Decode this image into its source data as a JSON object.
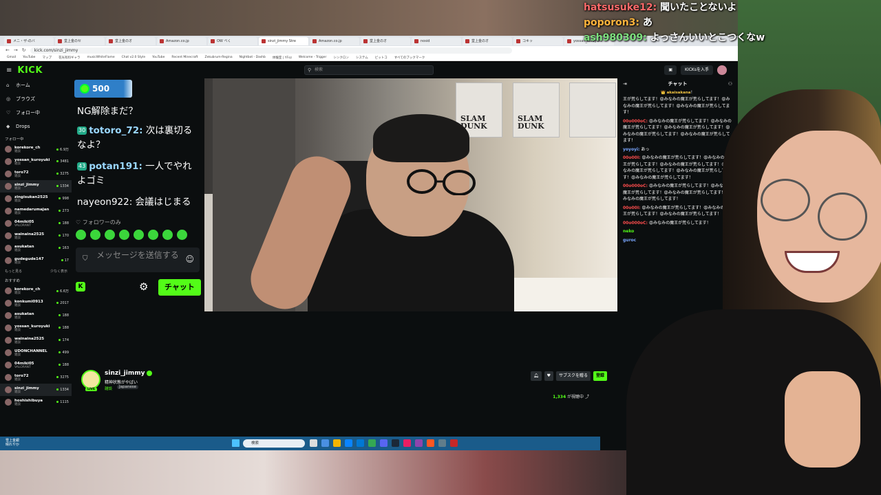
{
  "overlay_chat": [
    {
      "user": "hatsusuke12:",
      "text": "聞いたことないよ",
      "cls": ""
    },
    {
      "user": "poporon3:",
      "text": "あ",
      "cls": "y"
    },
    {
      "user": "ash980309:",
      "text": "よっさんいいとこつくなw",
      "cls": "g"
    }
  ],
  "browser": {
    "tabs": [
      "メニ・ザ-のバ",
      "堂上金のセ",
      "堂上金のオ",
      "Amazon.co.jp",
      "OW べく",
      "sinzi_jimmy Stre",
      "Amazon.co.jp",
      "堂上金のオ",
      "nosid",
      "堂上金のオ",
      "コキッ",
      "yossan_kuroyuki"
    ],
    "url": "kick.com/sinzi_jimmy",
    "bookmarks": [
      "Gmail",
      "YouTube",
      "マップ",
      "花光有料ギャラ",
      "musicWhiteFlame",
      "Chat v2.0 Style",
      "YouTube",
      "Recent Minecraft",
      "Zekubrum-Regina",
      "Nightbot - Dashb",
      "体験室 | YFsz",
      "Welcome - Trigger",
      "シンクロン",
      "システム",
      "ビットコ",
      "すべてのブックマーク"
    ]
  },
  "kick": {
    "logo": "KICK",
    "search_placeholder": "検索",
    "get_kicks": "KICKsを入手",
    "nav": [
      {
        "label": "ホーム",
        "icon": "home-icon",
        "glyph": "⌂"
      },
      {
        "label": "ブラウズ",
        "icon": "browse-icon",
        "glyph": "◎"
      },
      {
        "label": "フォロー中",
        "icon": "heart-icon",
        "glyph": "♡"
      },
      {
        "label": "Drops",
        "icon": "drops-icon",
        "glyph": "◆"
      }
    ],
    "following_title": "フォロー中",
    "following": [
      {
        "name": "korekore_ch",
        "cat": "雑談",
        "viewers": "6.9万"
      },
      {
        "name": "yossan_kuroyuki",
        "cat": "雑談",
        "viewers": "3481"
      },
      {
        "name": "toro72",
        "cat": "雑談",
        "viewers": "3275"
      },
      {
        "name": "sinzi_jimmy",
        "cat": "雑談",
        "viewers": "1334"
      },
      {
        "name": "zingisukan2525",
        "cat": "雑談",
        "viewers": "998"
      },
      {
        "name": "namedarumajan",
        "cat": "雑談",
        "viewers": "273"
      },
      {
        "name": "04miki05",
        "cat": "VALORANT",
        "viewers": "188"
      },
      {
        "name": "wainaina2525",
        "cat": "雑談",
        "viewers": "170"
      },
      {
        "name": "asukatan",
        "cat": "雑談",
        "viewers": "163"
      },
      {
        "name": "gudegude147",
        "cat": "雑談",
        "viewers": "17"
      }
    ],
    "show_more": "もっと見る",
    "show_less": "少なく表示",
    "recommended_title": "おすすめ",
    "recommended": [
      {
        "name": "korekore_ch",
        "cat": "雑談",
        "viewers": "6.6万"
      },
      {
        "name": "konkumi0913",
        "cat": "雑談",
        "viewers": "2017"
      },
      {
        "name": "asukatan",
        "cat": "雑談",
        "viewers": "188"
      },
      {
        "name": "yossan_kuroyuki",
        "cat": "雑談",
        "viewers": "188"
      },
      {
        "name": "wainaina2525",
        "cat": "雑談",
        "viewers": "174"
      },
      {
        "name": "UDONCHANNEL",
        "cat": "雑談",
        "viewers": "499"
      },
      {
        "name": "04miki05",
        "cat": "VALORANT",
        "viewers": "188"
      },
      {
        "name": "toro72",
        "cat": "雑談",
        "viewers": "3275"
      },
      {
        "name": "sinzi_jimmy",
        "cat": "雑談",
        "viewers": "1334"
      },
      {
        "name": "hoshishibuya",
        "cat": "雑談",
        "viewers": "1115"
      }
    ],
    "points": "500",
    "overlay_msgs": [
      {
        "badge": "",
        "user": "",
        "text": "NG解除まだ？"
      },
      {
        "badge": "30",
        "user": "totoro_72:",
        "text": " 次は裏切るなよ？"
      },
      {
        "badge": "43",
        "user": "potan191:",
        "text": " 一人でやれよゴミ"
      },
      {
        "badge": "",
        "user": "",
        "text": "nayeon922: 会議はじまる"
      }
    ],
    "followers_only": "フォロワーのみ",
    "message_placeholder": "メッセージを送信する",
    "send_label": "チャット",
    "stream": {
      "name": "sinzi_jimmy",
      "title": "精神状態がやばい",
      "category": "雑談",
      "language": "Japanese",
      "live": "LIVE",
      "subscribe": "サブスクを贈る",
      "follow": "登録",
      "viewers": "1,334",
      "viewers_suffix": "が視聴中"
    },
    "chat_title": "チャット",
    "chat_pinned_user": "akaisakana",
    "chat_pinned_suffix": "！",
    "chat": [
      {
        "user": "",
        "text": "王が荒らしてます！😡みなみの魔王が荒らしてます！😡みなみの魔王が荒らしてます！😡みなみの魔王が荒らしてます！",
        "cls": ""
      },
      {
        "user": "00o000oC:",
        "text": " 😡みなみの魔王が荒らしてます！😡みなみの魔王が荒らしてます！😡みなみの魔王が荒らしてます！😡みなみの魔王が荒らしてます！😡みなみの魔王が荒らしてます！",
        "cls": ""
      },
      {
        "user": "yoyoyi:",
        "text": " あっ",
        "cls": "b"
      },
      {
        "user": "00o00I:",
        "text": " 😡みなみの魔王が荒らしてます！😡みなみの魔王が荒らしてます！😡みなみの魔王が荒らしてます！😡みなみの魔王が荒らしてます！😡みなみの魔王が荒らしてます！😡みなみの魔王が荒らしてます！",
        "cls": ""
      },
      {
        "user": "00o000oC:",
        "text": " 😡みなみの魔王が荒らしてます！😡みなみの魔王が荒らしてます！😡みなみの魔王が荒らしてます！😡みなみの魔王が荒らしてます！",
        "cls": ""
      },
      {
        "user": "00o00I:",
        "text": " 😡みなみの魔王が荒らしてます！😡みなみの魔王が荒らしてます！😡みなみの魔王が荒らしてます！",
        "cls": ""
      },
      {
        "user": "00o000oC:",
        "text": " 😡みなみの魔王が荒らしてます！",
        "cls": ""
      },
      {
        "user": "neko",
        "text": "",
        "cls": "g"
      },
      {
        "user": "guroc",
        "text": "",
        "cls": "b"
      }
    ]
  },
  "taskbar": {
    "weather_line1": "雪上金銀",
    "weather_line2": "晴れやか",
    "search": "検索"
  },
  "video_posters": [
    "SLAM DUNK",
    "SLAM DUNK"
  ]
}
